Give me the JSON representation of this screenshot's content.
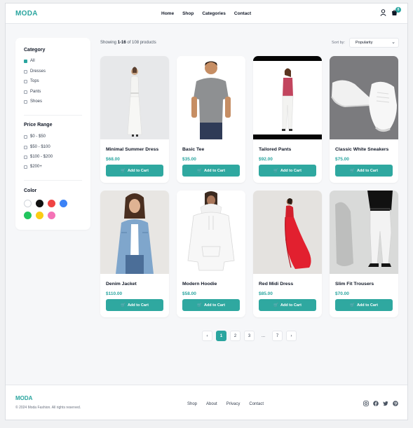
{
  "brand": "MODA",
  "nav": [
    "Home",
    "Shop",
    "Categories",
    "Contact"
  ],
  "cart_count": "0",
  "sidebar": {
    "category_title": "Category",
    "categories": [
      {
        "label": "All",
        "checked": true
      },
      {
        "label": "Dresses",
        "checked": false
      },
      {
        "label": "Tops",
        "checked": false
      },
      {
        "label": "Pants",
        "checked": false
      },
      {
        "label": "Shoes",
        "checked": false
      }
    ],
    "price_title": "Price Range",
    "prices": [
      "$0 - $50",
      "$50 - $100",
      "$100 - $200",
      "$200+"
    ],
    "color_title": "Color",
    "colors": [
      "#ffffff",
      "#111111",
      "#ef4444",
      "#3b82f6",
      "#22c55e",
      "#facc15",
      "#f472b6"
    ]
  },
  "results": {
    "showing_prefix": "Showing ",
    "showing_range": "1-16",
    "showing_suffix": " of 108 products",
    "sort_label": "Sort by:",
    "sort_value": "Popularity"
  },
  "products": [
    {
      "name": "Minimal Summer Dress",
      "price": "$68.00",
      "cta": "Add to Cart"
    },
    {
      "name": "Basic Tee",
      "price": "$35.00",
      "cta": "Add to Cart"
    },
    {
      "name": "Tailored Pants",
      "price": "$92.00",
      "cta": "Add to Cart"
    },
    {
      "name": "Classic White Sneakers",
      "price": "$75.00",
      "cta": "Add to Cart"
    },
    {
      "name": "Denim Jacket",
      "price": "$110.00",
      "cta": "Add to Cart"
    },
    {
      "name": "Modern Hoodie",
      "price": "$58.00",
      "cta": "Add to Cart"
    },
    {
      "name": "Red Midi Dress",
      "price": "$85.00",
      "cta": "Add to Cart"
    },
    {
      "name": "Slim Fit Trousers",
      "price": "$70.00",
      "cta": "Add to Cart"
    }
  ],
  "pagination": {
    "prev": "‹",
    "pages": [
      "1",
      "2",
      "3",
      "...",
      "7"
    ],
    "next": "›",
    "current": "1"
  },
  "footer": {
    "brand": "MODA",
    "copyright": "© 2024 Moda Fashion. All rights reserved.",
    "links": [
      "Shop",
      "About",
      "Privacy",
      "Contact"
    ],
    "social": [
      "instagram-icon",
      "facebook-icon",
      "twitter-icon",
      "pinterest-icon"
    ]
  },
  "accent_color": "#2aa59f"
}
